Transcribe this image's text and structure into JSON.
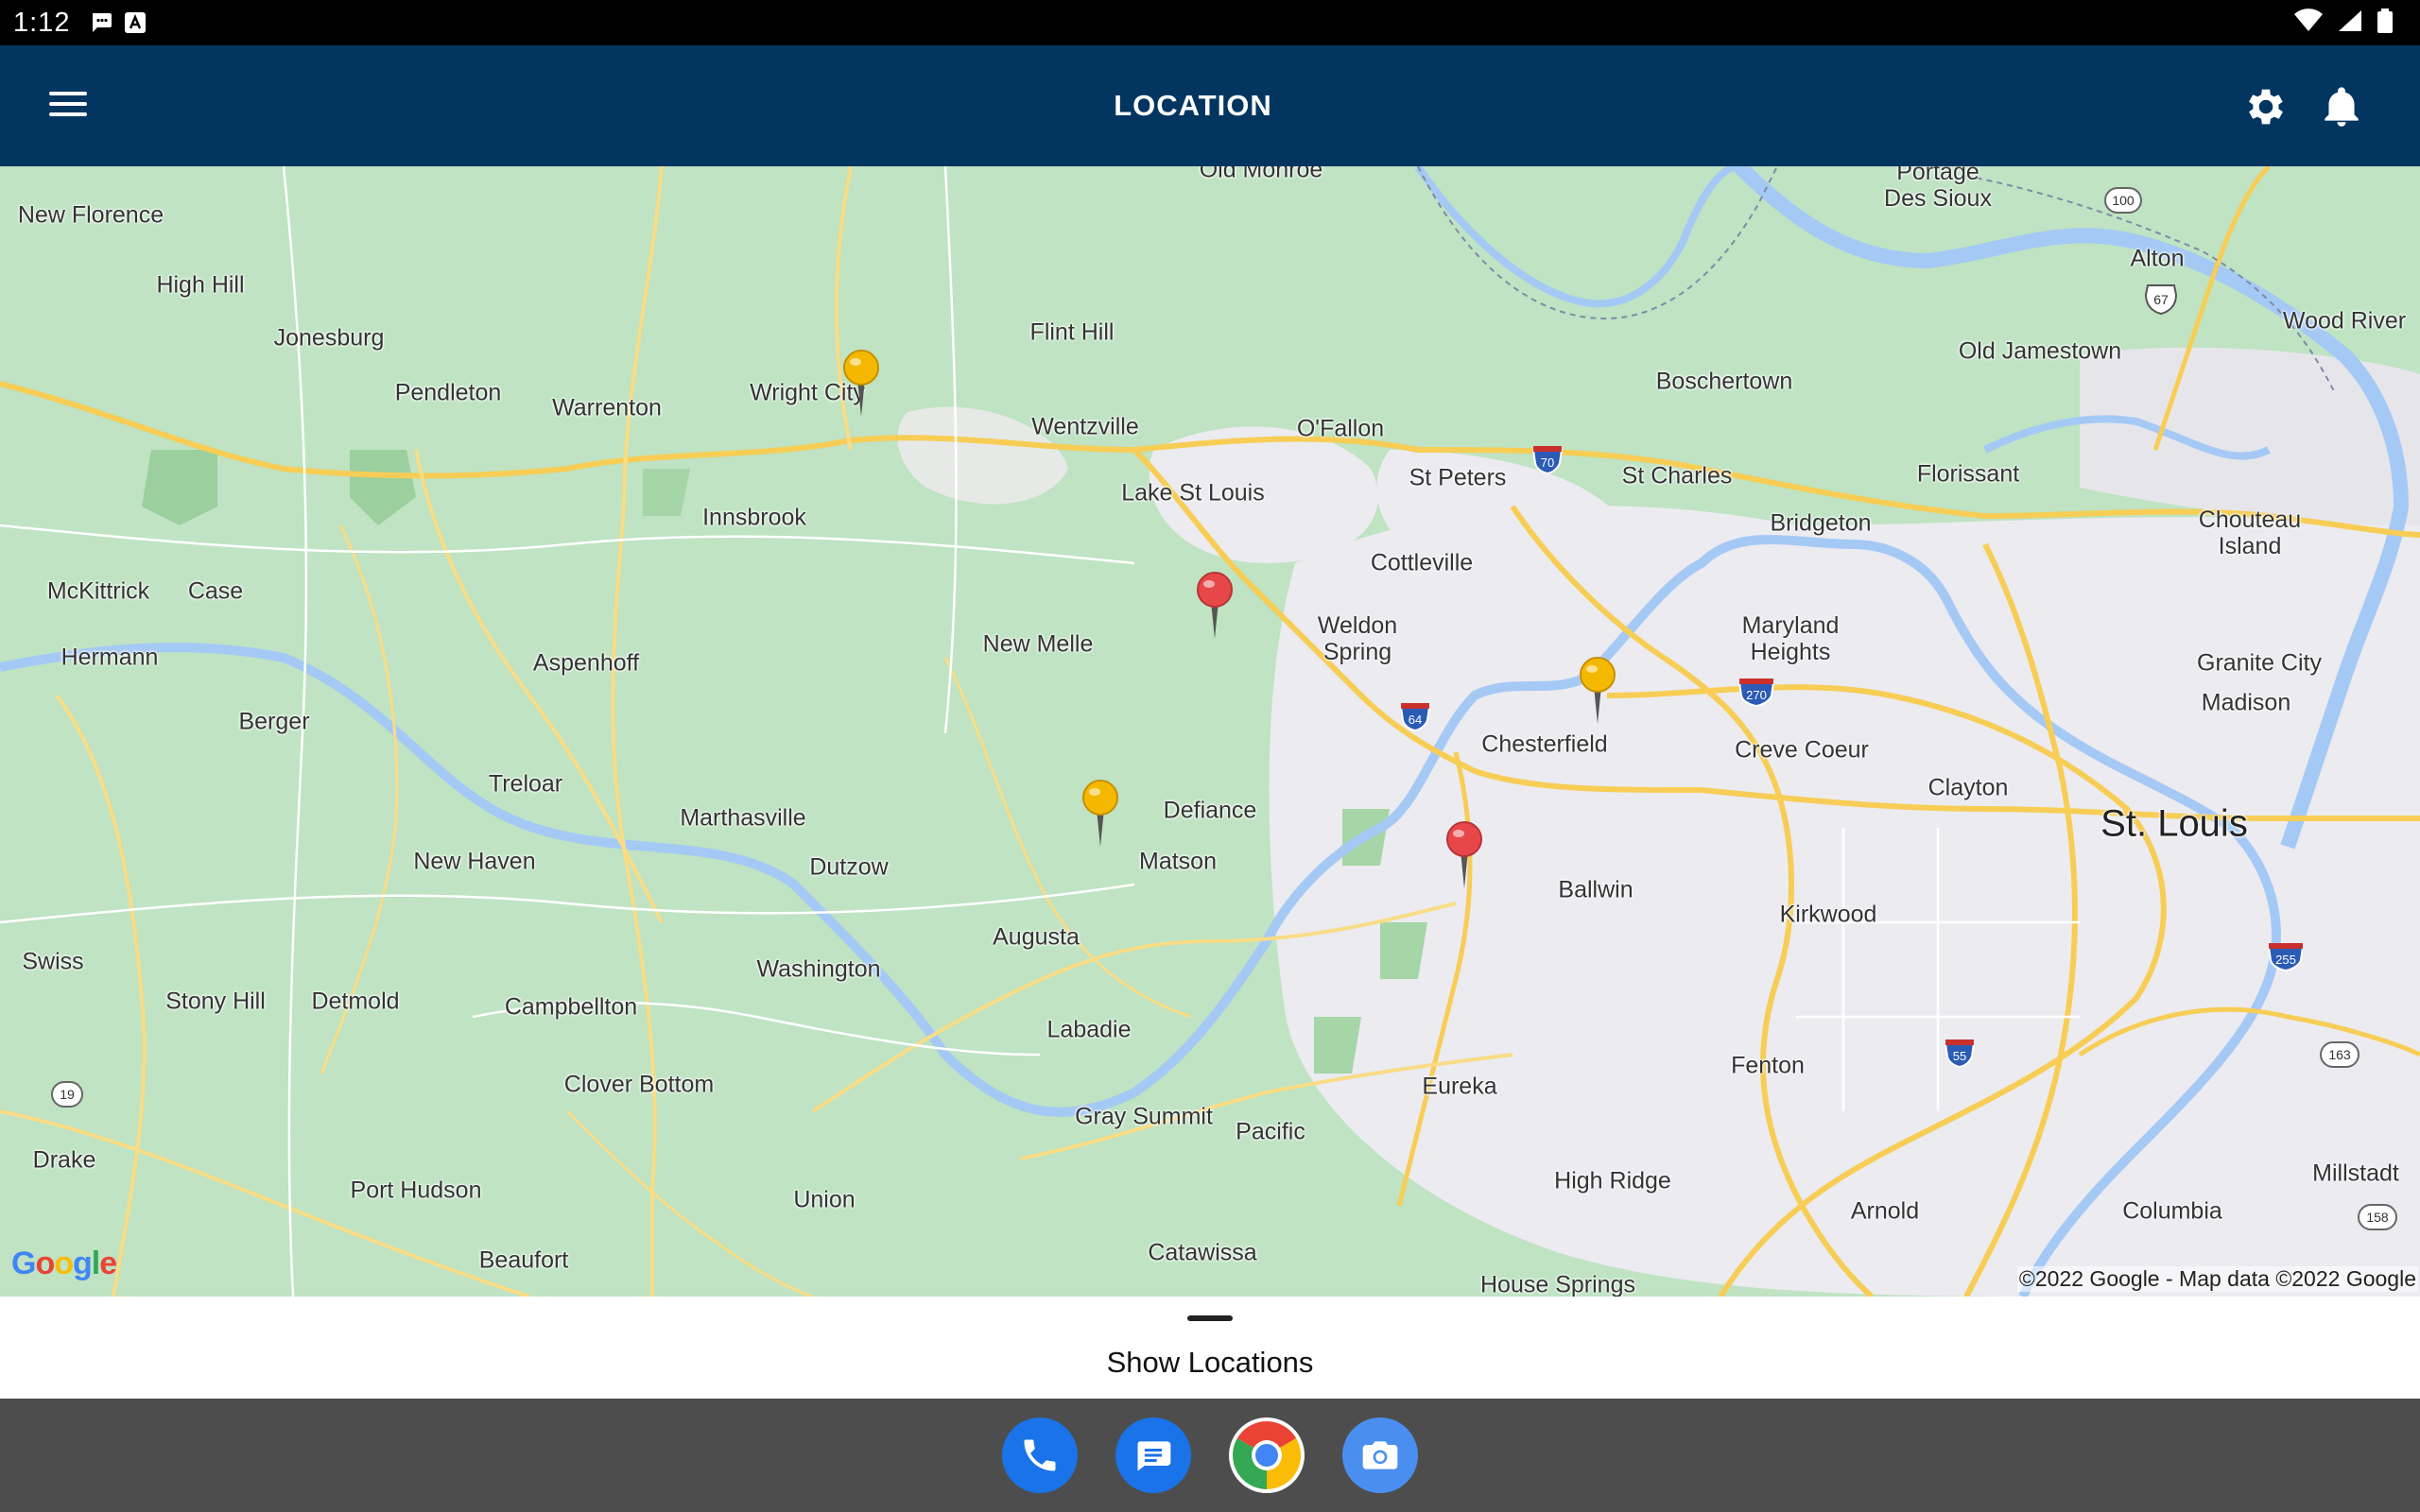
{
  "status_bar": {
    "time": "1:12"
  },
  "app_bar": {
    "title": "LOCATION"
  },
  "map": {
    "places": [
      {
        "id": "old-monroe",
        "label": "Old Monroe"
      },
      {
        "id": "portage-des-sioux",
        "label": "Portage\nDes Sioux"
      },
      {
        "id": "alton",
        "label": "Alton"
      },
      {
        "id": "new-florence",
        "label": "New Florence"
      },
      {
        "id": "high-hill",
        "label": "High Hill"
      },
      {
        "id": "jonesburg",
        "label": "Jonesburg"
      },
      {
        "id": "flint-hill",
        "label": "Flint Hill"
      },
      {
        "id": "wood-river",
        "label": "Wood River"
      },
      {
        "id": "old-jamestown",
        "label": "Old Jamestown"
      },
      {
        "id": "boschertown",
        "label": "Boschertown"
      },
      {
        "id": "pendleton",
        "label": "Pendleton"
      },
      {
        "id": "warrenton",
        "label": "Warrenton"
      },
      {
        "id": "wright-city",
        "label": "Wright City"
      },
      {
        "id": "wentzville",
        "label": "Wentzville"
      },
      {
        "id": "ofallon",
        "label": "O'Fallon"
      },
      {
        "id": "st-peters",
        "label": "St Peters"
      },
      {
        "id": "st-charles",
        "label": "St Charles"
      },
      {
        "id": "florissant",
        "label": "Florissant"
      },
      {
        "id": "lake-st-louis",
        "label": "Lake St Louis"
      },
      {
        "id": "innsbrook",
        "label": "Innsbrook"
      },
      {
        "id": "bridgeton",
        "label": "Bridgeton"
      },
      {
        "id": "chouteau-island",
        "label": "Chouteau\nIsland"
      },
      {
        "id": "cottleville",
        "label": "Cottleville"
      },
      {
        "id": "mckittrick",
        "label": "McKittrick"
      },
      {
        "id": "case",
        "label": "Case"
      },
      {
        "id": "weldon-spring",
        "label": "Weldon\nSpring"
      },
      {
        "id": "maryland-heights",
        "label": "Maryland\nHeights"
      },
      {
        "id": "hermann",
        "label": "Hermann"
      },
      {
        "id": "aspenhoff",
        "label": "Aspenhoff"
      },
      {
        "id": "new-melle",
        "label": "New Melle"
      },
      {
        "id": "granite-city",
        "label": "Granite City"
      },
      {
        "id": "madison",
        "label": "Madison"
      },
      {
        "id": "berger",
        "label": "Berger"
      },
      {
        "id": "chesterfield",
        "label": "Chesterfield"
      },
      {
        "id": "creve-coeur",
        "label": "Creve Coeur"
      },
      {
        "id": "treloar",
        "label": "Treloar"
      },
      {
        "id": "clayton",
        "label": "Clayton"
      },
      {
        "id": "defiance",
        "label": "Defiance"
      },
      {
        "id": "marthasville",
        "label": "Marthasville"
      },
      {
        "id": "st-louis",
        "label": "St. Louis"
      },
      {
        "id": "new-haven",
        "label": "New Haven"
      },
      {
        "id": "dutzow",
        "label": "Dutzow"
      },
      {
        "id": "matson",
        "label": "Matson"
      },
      {
        "id": "ballwin",
        "label": "Ballwin"
      },
      {
        "id": "kirkwood",
        "label": "Kirkwood"
      },
      {
        "id": "augusta",
        "label": "Augusta"
      },
      {
        "id": "swiss",
        "label": "Swiss"
      },
      {
        "id": "washington",
        "label": "Washington"
      },
      {
        "id": "stony-hill",
        "label": "Stony Hill"
      },
      {
        "id": "detmold",
        "label": "Detmold"
      },
      {
        "id": "campbellton",
        "label": "Campbellton"
      },
      {
        "id": "labadie",
        "label": "Labadie"
      },
      {
        "id": "fenton",
        "label": "Fenton"
      },
      {
        "id": "clover-bottom",
        "label": "Clover Bottom"
      },
      {
        "id": "eureka",
        "label": "Eureka"
      },
      {
        "id": "gray-summit",
        "label": "Gray Summit"
      },
      {
        "id": "pacific",
        "label": "Pacific"
      },
      {
        "id": "drake",
        "label": "Drake"
      },
      {
        "id": "high-ridge",
        "label": "High Ridge"
      },
      {
        "id": "millstadt",
        "label": "Millstadt"
      },
      {
        "id": "port-hudson",
        "label": "Port Hudson"
      },
      {
        "id": "union",
        "label": "Union"
      },
      {
        "id": "arnold",
        "label": "Arnold"
      },
      {
        "id": "columbia",
        "label": "Columbia"
      },
      {
        "id": "catawissa",
        "label": "Catawissa"
      },
      {
        "id": "beaufort",
        "label": "Beaufort"
      },
      {
        "id": "house-springs",
        "label": "House Springs"
      }
    ],
    "shields": {
      "us100": "100",
      "us67": "67",
      "i70": "70",
      "i270": "270",
      "i64": "64",
      "i255": "255",
      "i55": "55",
      "r163": "163",
      "r19": "19",
      "r158": "158"
    },
    "pins": [
      {
        "id": "pin-1",
        "color": "#f5b800"
      },
      {
        "id": "pin-2",
        "color": "#e8474a"
      },
      {
        "id": "pin-3",
        "color": "#f5b800"
      },
      {
        "id": "pin-4",
        "color": "#f5b800"
      },
      {
        "id": "pin-5",
        "color": "#e8474a"
      }
    ],
    "copyright": "©2022 Google - Map data ©2022 Google",
    "logo": "Google"
  },
  "sheet": {
    "label": "Show Locations"
  },
  "dock": {
    "apps": [
      {
        "id": "phone",
        "color": "#1a73e8"
      },
      {
        "id": "messages",
        "color": "#1a73e8"
      },
      {
        "id": "chrome",
        "color": "#ffffff"
      },
      {
        "id": "camera",
        "color": "#4a8ff0"
      }
    ]
  }
}
